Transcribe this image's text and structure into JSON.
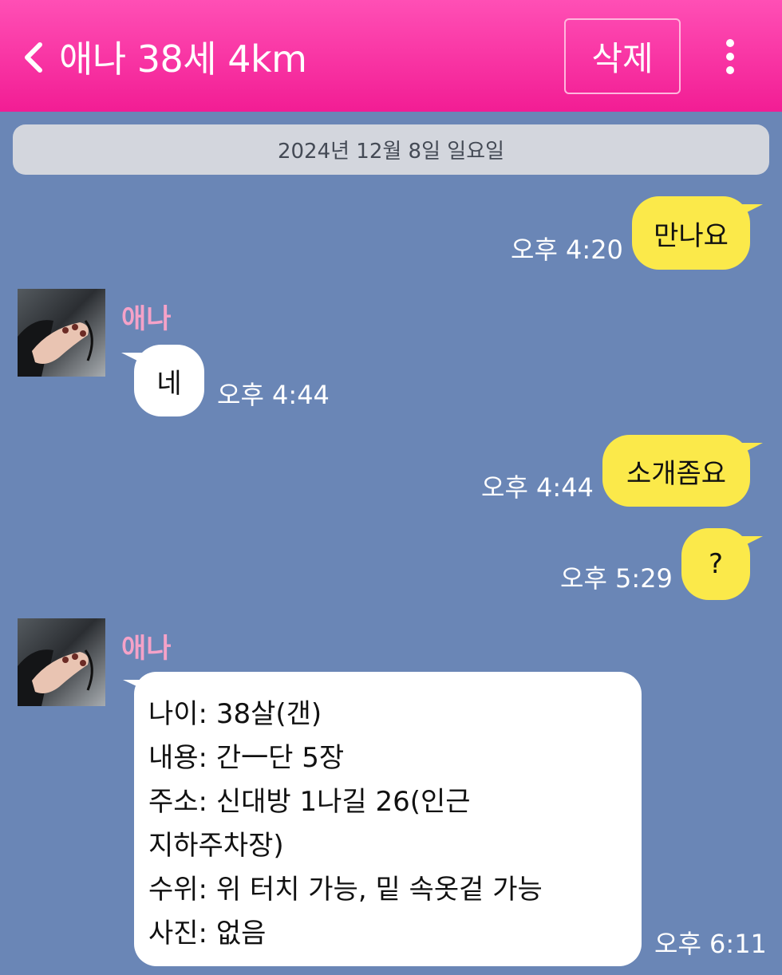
{
  "header": {
    "title": "애나 38세 4km",
    "delete_label": "삭제",
    "icons": [
      "back-icon",
      "more-icon"
    ]
  },
  "date_separator": "2024년 12월 8일 일요일",
  "messages": [
    {
      "side": "mine",
      "text": "만나요",
      "time": "오후 4:20"
    },
    {
      "side": "theirs",
      "sender": "애나",
      "text": "네",
      "time": "오후 4:44"
    },
    {
      "side": "mine",
      "text": "소개좀요",
      "time": "오후 4:44"
    },
    {
      "side": "mine",
      "text": "?",
      "time": "오후 5:29"
    },
    {
      "side": "theirs",
      "sender": "애나",
      "lines": [
        "나이: 38살(갠)",
        "내용: 간一단 5장",
        "주소: 신대방 1나길 26(인근",
        "지하주차장)",
        "수위: 위 터치 가능, 밑 속옷겉 가능",
        "사진: 없음"
      ],
      "time": "오후 6:11"
    }
  ],
  "colors": {
    "header": "#f21d94",
    "background": "#6a86b6",
    "my_bubble": "#fbe94a",
    "their_bubble": "#ffffff",
    "sender_name": "#f5a2c8"
  }
}
